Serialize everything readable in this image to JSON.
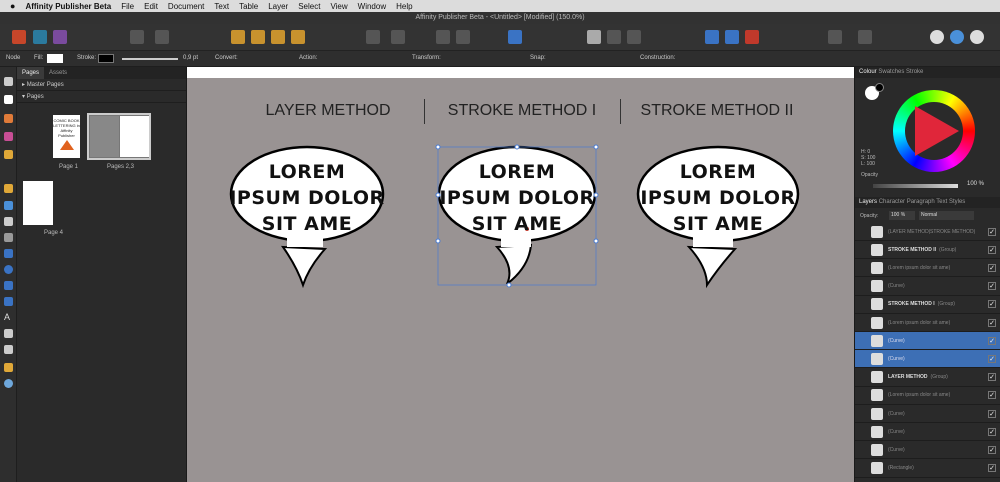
{
  "menubar": {
    "apple": "",
    "app_name": "Affinity Publisher Beta",
    "items": [
      "File",
      "Edit",
      "Document",
      "Text",
      "Table",
      "Layer",
      "Select",
      "View",
      "Window",
      "Help"
    ]
  },
  "window": {
    "title": "Affinity Publisher Beta - <Untitled> [Modified] (150.0%)"
  },
  "context_toolbar": {
    "tool": "Node",
    "fill_label": "Fill:",
    "stroke_label": "Stroke:",
    "stroke_width": "0,9 pt",
    "convert_label": "Convert:",
    "action_label": "Action:",
    "transform_label": "Transform:",
    "snap_label": "Snap:",
    "construction_label": "Construction:"
  },
  "pages_panel": {
    "tabs": [
      "Pages",
      "Assets"
    ],
    "master_pages": "Master Pages",
    "pages": "Pages",
    "page1_caption": "Page 1",
    "page23_caption": "Pages 2,3",
    "page4_caption": "Page 4",
    "page1_thumb_text": "COMIC BOOK LETTERING in Affinity Publisher"
  },
  "canvas": {
    "headings": [
      "LAYER METHOD",
      "STROKE METHOD I",
      "STROKE METHOD II"
    ],
    "bubble_lines": [
      "LOREM",
      "IPSUM DOLOR",
      "SIT AME"
    ]
  },
  "right_panel": {
    "tabs": [
      "Colour",
      "Swatches",
      "Stroke"
    ],
    "hsl": {
      "h": "H: 0",
      "s": "S: 100",
      "l": "L: 100"
    },
    "opacity_label": "Opacity",
    "opacity_value": "100 %",
    "layer_tabs": [
      "Layers",
      "Character",
      "Paragraph",
      "Text Styles"
    ],
    "layer_opacity_label": "Opacity:",
    "layer_opacity_value": "100 %",
    "blend_mode": "Normal",
    "layers": [
      {
        "name": "(LAYER METHOD|STROKE METHOD)",
        "bold": false,
        "selected": false
      },
      {
        "name": "STROKE METHOD II",
        "suffix": "(Group)",
        "bold": true,
        "selected": false
      },
      {
        "name": "(Lorem ipsum dolor sit ame)",
        "bold": false,
        "selected": false
      },
      {
        "name": "(Curve)",
        "bold": false,
        "selected": false
      },
      {
        "name": "STROKE METHOD I",
        "suffix": "(Group)",
        "bold": true,
        "selected": false
      },
      {
        "name": "(Lorem ipsum dolor sit ame)",
        "bold": false,
        "selected": false
      },
      {
        "name": "(Curve)",
        "bold": false,
        "selected": true
      },
      {
        "name": "(Curve)",
        "bold": false,
        "selected": true
      },
      {
        "name": "LAYER METHOD",
        "suffix": "(Group)",
        "bold": true,
        "selected": false
      },
      {
        "name": "(Lorem ipsum dolor sit ame)",
        "bold": false,
        "selected": false
      },
      {
        "name": "(Curve)",
        "bold": false,
        "selected": false
      },
      {
        "name": "(Curve)",
        "bold": false,
        "selected": false
      },
      {
        "name": "(Curve)",
        "bold": false,
        "selected": false
      },
      {
        "name": "(Rectangle)",
        "bold": false,
        "selected": false
      }
    ]
  },
  "colors": {
    "selection": "#3d6fb5",
    "canvas_bg": "#999393",
    "wheel_accent": "#e0263a"
  }
}
